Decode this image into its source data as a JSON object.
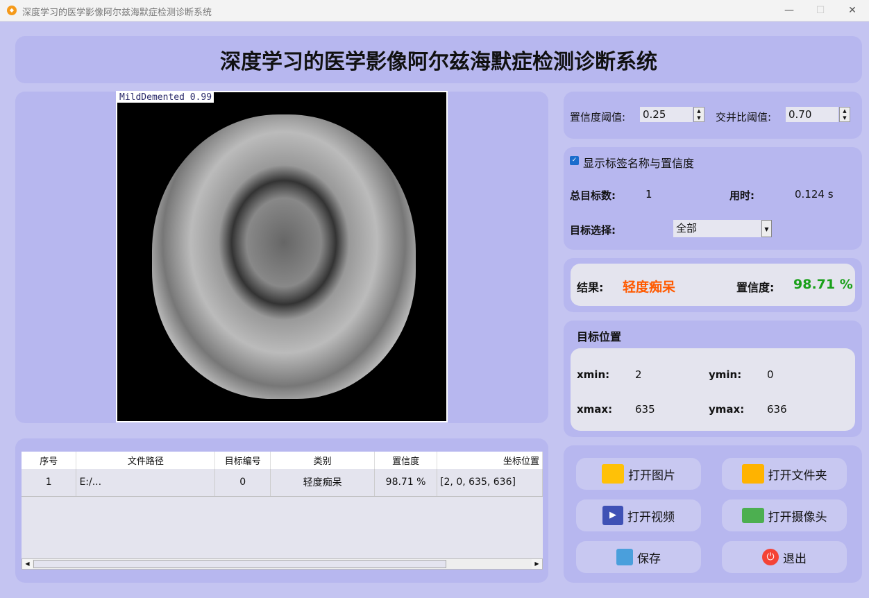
{
  "window": {
    "title": "深度学习的医学影像阿尔兹海默症检测诊断系统",
    "minimize": "—",
    "maximize": "☐",
    "close": "✕"
  },
  "header": {
    "title": "深度学习的医学影像阿尔兹海默症检测诊断系统"
  },
  "image": {
    "detection_label": "MildDemented 0.99"
  },
  "table": {
    "columns": [
      "序号",
      "文件路径",
      "目标编号",
      "类别",
      "置信度",
      "坐标位置"
    ],
    "rows": [
      [
        "1",
        "E:/...",
        "0",
        "轻度痴呆",
        "98.71 %",
        "[2, 0, 635, 636]"
      ]
    ]
  },
  "settings": {
    "conf_label": "置信度阈值:",
    "conf_value": "0.25",
    "iou_label": "交并比阈值:",
    "iou_value": "0.70"
  },
  "stats": {
    "show_label": "显示标签名称与置信度",
    "show_checked": true,
    "total_label": "总目标数:",
    "total_value": "1",
    "time_label": "用时:",
    "time_value": "0.124 s",
    "select_label": "目标选择:",
    "select_value": "全部"
  },
  "result": {
    "label": "结果:",
    "value": "轻度痴呆",
    "conf_label": "置信度:",
    "conf_value": "98.71 %",
    "value_color": "#ff5a00",
    "conf_color": "#1aa01a"
  },
  "position": {
    "title": "目标位置",
    "xmin_label": "xmin:",
    "xmin": "2",
    "ymin_label": "ymin:",
    "ymin": "0",
    "xmax_label": "xmax:",
    "xmax": "635",
    "ymax_label": "ymax:",
    "ymax": "636"
  },
  "buttons": {
    "open_image": "打开图片",
    "open_folder": "打开文件夹",
    "open_video": "打开视频",
    "open_camera": "打开摄像头",
    "save": "保存",
    "exit": "退出"
  }
}
